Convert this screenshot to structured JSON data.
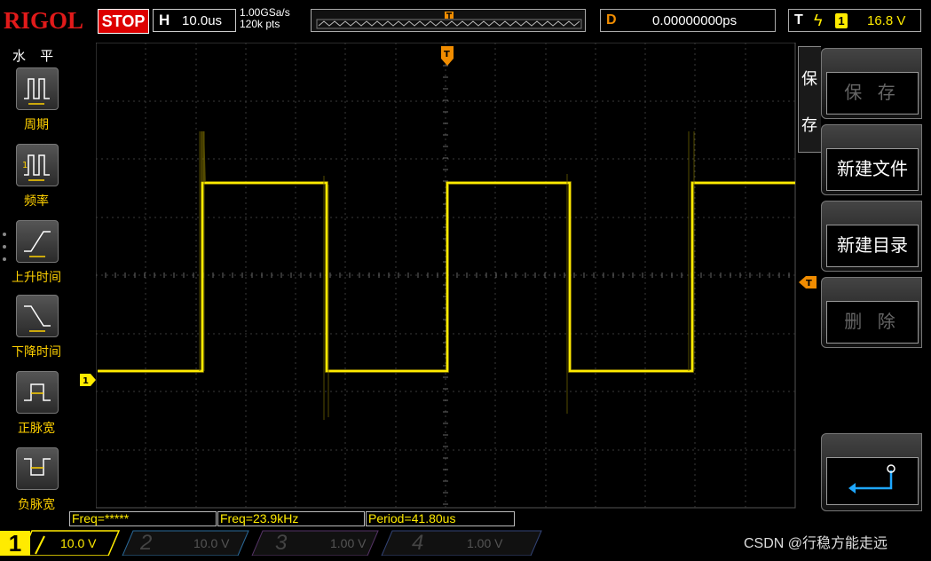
{
  "header": {
    "brand": "RIGOL",
    "run_state": "STOP",
    "horizontal_letter": "H",
    "timebase": "10.0us",
    "sample_rate": "1.00GSa/s",
    "memory_depth": "120k pts",
    "delay_letter": "D",
    "delay": "0.00000000ps",
    "trigger_letter": "T",
    "trigger_channel": "1",
    "trigger_level": "16.8 V"
  },
  "left_menu": {
    "title": "水 平",
    "items": [
      {
        "label": "周期",
        "icon": "period-icon"
      },
      {
        "label": "频率",
        "icon": "frequency-icon"
      },
      {
        "label": "上升时间",
        "icon": "rise-time-icon"
      },
      {
        "label": "下降时间",
        "icon": "fall-time-icon"
      },
      {
        "label": "正脉宽",
        "icon": "positive-width-icon"
      },
      {
        "label": "负脉宽",
        "icon": "negative-width-icon"
      }
    ]
  },
  "right_menu": {
    "tab_label_1": "保",
    "tab_label_2": "存",
    "buttons": [
      {
        "label": "保 存",
        "enabled": false
      },
      {
        "label": "新建文件",
        "enabled": true
      },
      {
        "label": "新建目录",
        "enabled": true
      },
      {
        "label": "删 除",
        "enabled": false
      }
    ]
  },
  "markers": {
    "ch1_marker": "1",
    "trigger_marker": "T"
  },
  "measurements": [
    {
      "text": "Freq=*****"
    },
    {
      "text": "Freq=23.9kHz"
    },
    {
      "text": "Period=41.80us"
    }
  ],
  "channels": [
    {
      "num": "1",
      "scale": "10.0 V",
      "active": true
    },
    {
      "num": "2",
      "scale": "10.0 V",
      "active": false
    },
    {
      "num": "3",
      "scale": "1.00 V",
      "active": false
    },
    {
      "num": "4",
      "scale": "1.00 V",
      "active": false
    }
  ],
  "watermark": "CSDN @行稳方能走远",
  "colors": {
    "ch1": "#ffeb00",
    "brand": "#e11a1a",
    "trigger_marker": "#f08c00"
  }
}
